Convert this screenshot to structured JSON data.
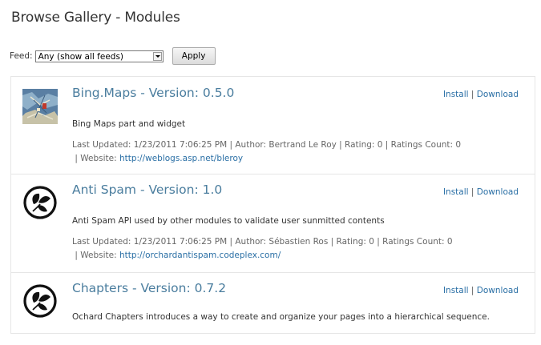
{
  "page": {
    "title": "Browse Gallery - Modules"
  },
  "filter": {
    "feed_label": "Feed:",
    "feed_selected": "Any (show all feeds)",
    "apply_label": "Apply"
  },
  "labels": {
    "install": "Install",
    "separator": "|",
    "download": "Download"
  },
  "modules": [
    {
      "title": "Bing.Maps - Version: 0.5.0",
      "icon": "map-thumbnail-icon",
      "description": "Bing Maps part and widget",
      "meta_line": "Last Updated: 1/23/2011 7:06:25 PM | Author: Bertrand Le Roy | Rating: 0 | Ratings Count: 0",
      "website_prefix": " | Website: ",
      "website": "http://weblogs.asp.net/bleroy"
    },
    {
      "title": "Anti Spam - Version: 1.0",
      "icon": "orchard-logo-icon",
      "description": "Anti Spam API used by other modules to validate user sunmitted contents",
      "meta_line": "Last Updated: 1/23/2011 7:06:25 PM | Author: Sébastien Ros | Rating: 0 | Ratings Count: 0",
      "website_prefix": " | Website: ",
      "website": "http://orchardantispam.codeplex.com/"
    },
    {
      "title": "Chapters - Version: 0.7.2",
      "icon": "orchard-logo-icon",
      "description": "Ochard Chapters introduces a way to create and organize your pages into a hierarchical sequence."
    }
  ]
}
